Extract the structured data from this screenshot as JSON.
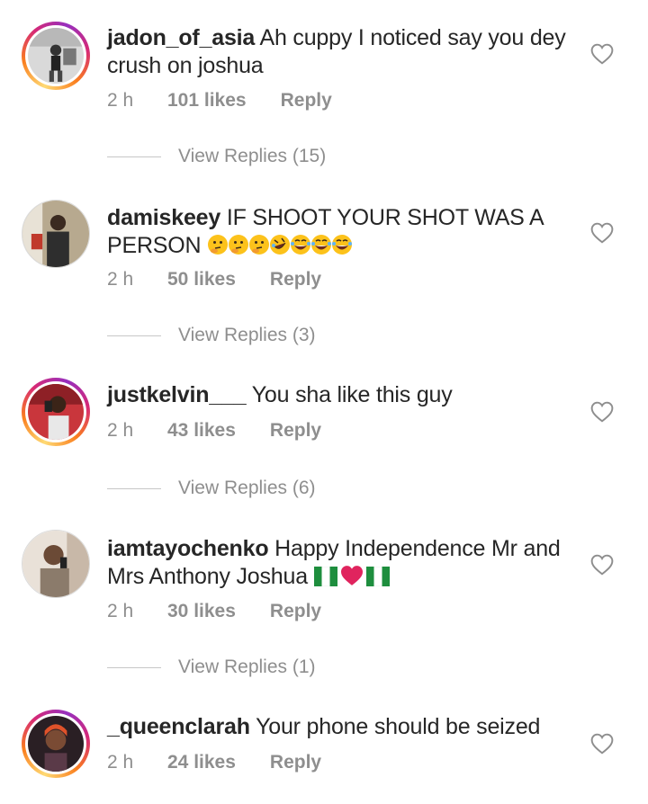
{
  "comments": [
    {
      "username": "jadon_of_asia",
      "text": " Ah cuppy I noticed say you dey crush on joshua",
      "time": "2 h",
      "likes": "101 likes",
      "reply": "Reply",
      "view_replies": "View Replies (15)",
      "avatar_ring": "story"
    },
    {
      "username": "damiskeey",
      "text": " IF SHOOT YOUR SHOT WAS A PERSON ",
      "emojis": [
        "thinking-face",
        "thinking-face",
        "thinking-face",
        "rolling-laughing-face",
        "tears-of-joy-face",
        "tears-of-joy-face",
        "tears-of-joy-face"
      ],
      "time": "2 h",
      "likes": "50 likes",
      "reply": "Reply",
      "view_replies": "View Replies (3)",
      "avatar_ring": "none"
    },
    {
      "username": "justkelvin___",
      "text": " You sha like this guy",
      "time": "2 h",
      "likes": "43 likes",
      "reply": "Reply",
      "view_replies": "View Replies (6)",
      "avatar_ring": "story"
    },
    {
      "username": "iamtayochenko",
      "text": " Happy Independence Mr and Mrs Anthony Joshua ",
      "emojis": [
        "nigeria-flag",
        "red-heart",
        "nigeria-flag"
      ],
      "time": "2 h",
      "likes": "30 likes",
      "reply": "Reply",
      "view_replies": "View Replies (1)",
      "avatar_ring": "none"
    },
    {
      "username": "_queenclarah",
      "text": " Your phone should be seized",
      "time": "2 h",
      "likes": "24 likes",
      "reply": "Reply",
      "avatar_ring": "story"
    }
  ],
  "icons": {
    "like": "heart-outline-icon"
  },
  "colors": {
    "username": "#262626",
    "meta": "#8e8e8e",
    "story_ring_start": "#feda75",
    "story_ring_end": "#962fbf"
  }
}
